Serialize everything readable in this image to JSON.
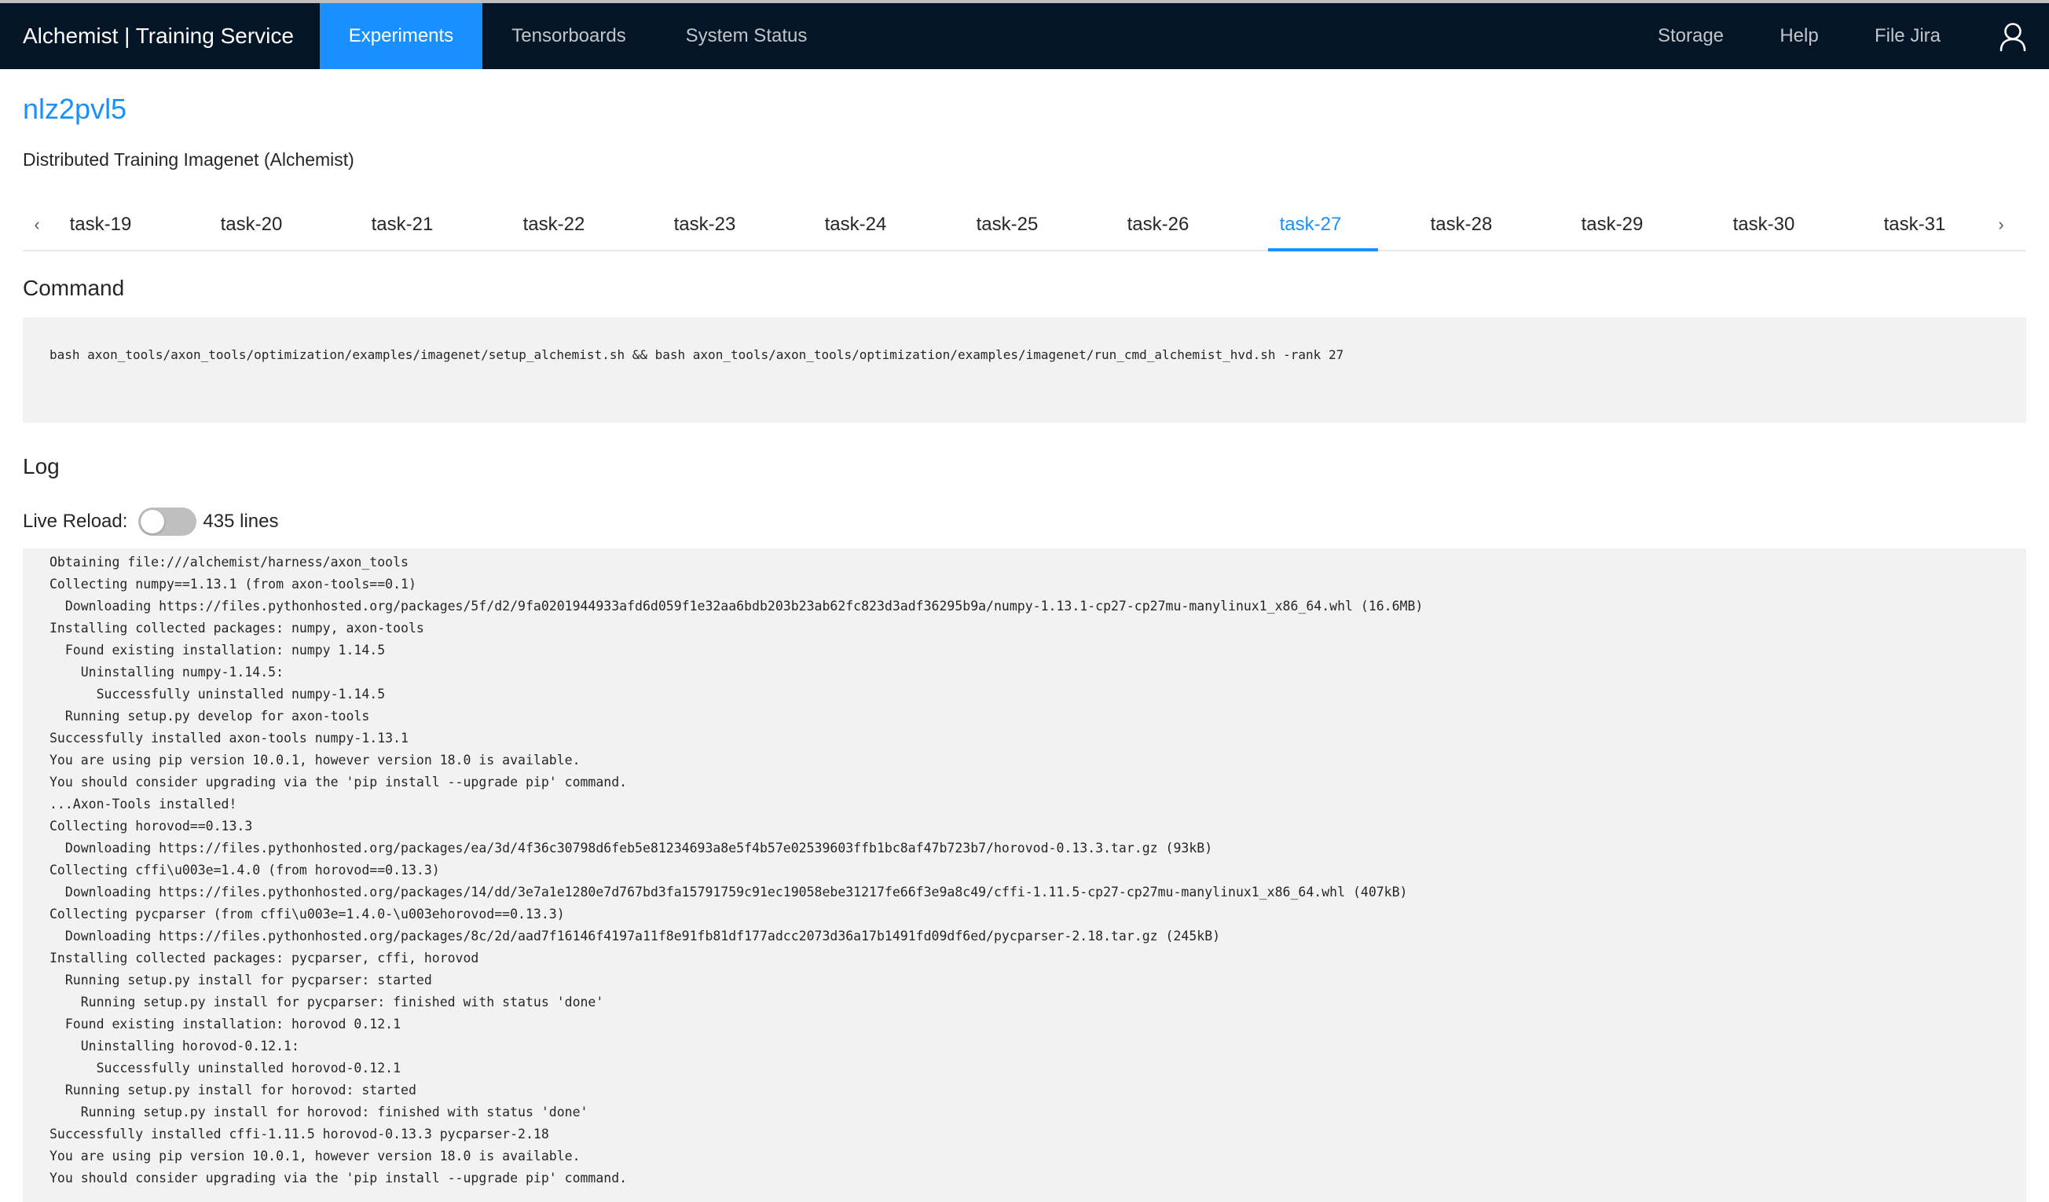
{
  "header": {
    "brand": "Alchemist | Training Service",
    "nav": [
      {
        "label": "Experiments",
        "active": true
      },
      {
        "label": "Tensorboards",
        "active": false
      },
      {
        "label": "System Status",
        "active": false
      }
    ],
    "right_nav": [
      {
        "label": "Storage"
      },
      {
        "label": "Help"
      },
      {
        "label": "File Jira"
      }
    ],
    "user_icon": "user-icon"
  },
  "experiment": {
    "id": "nlz2pvl5",
    "description": "Distributed Training Imagenet (Alchemist)"
  },
  "tabs": {
    "prev_icon": "‹",
    "next_icon": "›",
    "items": [
      "task-19",
      "task-20",
      "task-21",
      "task-22",
      "task-23",
      "task-24",
      "task-25",
      "task-26",
      "task-27",
      "task-28",
      "task-29",
      "task-30",
      "task-31"
    ],
    "active": "task-27"
  },
  "command": {
    "title": "Command",
    "text": "bash axon_tools/axon_tools/optimization/examples/imagenet/setup_alchemist.sh && bash axon_tools/axon_tools/optimization/examples/imagenet/run_cmd_alchemist_hvd.sh -rank 27"
  },
  "log": {
    "title": "Log",
    "live_reload_label": "Live Reload",
    "live_reload_on": false,
    "line_count": "435 lines",
    "lines": [
      "Obtaining file:///alchemist/harness/axon_tools",
      "Collecting numpy==1.13.1 (from axon-tools==0.1)",
      "  Downloading https://files.pythonhosted.org/packages/5f/d2/9fa0201944933afd6d059f1e32aa6bdb203b23ab62fc823d3adf36295b9a/numpy-1.13.1-cp27-cp27mu-manylinux1_x86_64.whl (16.6MB)",
      "Installing collected packages: numpy, axon-tools",
      "  Found existing installation: numpy 1.14.5",
      "    Uninstalling numpy-1.14.5:",
      "      Successfully uninstalled numpy-1.14.5",
      "  Running setup.py develop for axon-tools",
      "Successfully installed axon-tools numpy-1.13.1",
      "You are using pip version 10.0.1, however version 18.0 is available.",
      "You should consider upgrading via the 'pip install --upgrade pip' command.",
      "...Axon-Tools installed!",
      "Collecting horovod==0.13.3",
      "  Downloading https://files.pythonhosted.org/packages/ea/3d/4f36c30798d6feb5e81234693a8e5f4b57e02539603ffb1bc8af47b723b7/horovod-0.13.3.tar.gz (93kB)",
      "Collecting cffi\\u003e=1.4.0 (from horovod==0.13.3)",
      "  Downloading https://files.pythonhosted.org/packages/14/dd/3e7a1e1280e7d767bd3fa15791759c91ec19058ebe31217fe66f3e9a8c49/cffi-1.11.5-cp27-cp27mu-manylinux1_x86_64.whl (407kB)",
      "Collecting pycparser (from cffi\\u003e=1.4.0-\\u003ehorovod==0.13.3)",
      "  Downloading https://files.pythonhosted.org/packages/8c/2d/aad7f16146f4197a11f8e91fb81df177adcc2073d36a17b1491fd09df6ed/pycparser-2.18.tar.gz (245kB)",
      "Installing collected packages: pycparser, cffi, horovod",
      "  Running setup.py install for pycparser: started",
      "    Running setup.py install for pycparser: finished with status 'done'",
      "  Found existing installation: horovod 0.12.1",
      "    Uninstalling horovod-0.12.1:",
      "      Successfully uninstalled horovod-0.12.1",
      "  Running setup.py install for horovod: started",
      "    Running setup.py install for horovod: finished with status 'done'",
      "Successfully installed cffi-1.11.5 horovod-0.13.3 pycparser-2.18",
      "You are using pip version 10.0.1, however version 18.0 is available.",
      "You should consider upgrading via the 'pip install --upgrade pip' command."
    ]
  },
  "colors": {
    "header_bg": "#041527",
    "accent": "#1890ff",
    "panel_bg": "#f2f2f2"
  }
}
